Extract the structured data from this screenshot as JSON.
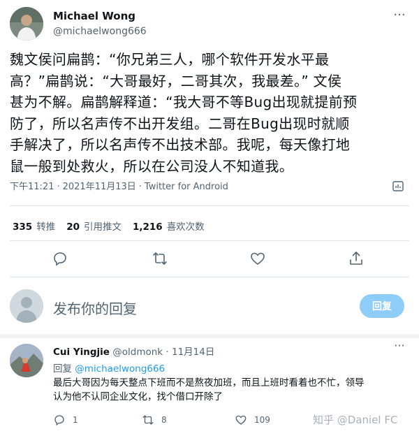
{
  "tweet": {
    "author_name": "Michael Wong",
    "author_handle": "@michaelwong666",
    "more_icon": "more-horizontal-icon",
    "text_lines": [
      "魏文侯问扁鹊：“你兄弟三人，哪个软件开发水平最",
      "高？”扁鹊说：“大哥最好，二哥其次，我最差。” 文侯",
      "甚为不解。扁鹊解释道：“我大哥不等Bug出现就提前预",
      "防了，所以名声传不出开发组。二哥在Bug出现时就顺",
      "手解决了，所以名声传不出技术部。我呢，每天像打地",
      "鼠一般到处救火，所以在公司没人不知道我。"
    ],
    "time": "下午11:21",
    "date": "2021年11月13日",
    "separator": "·",
    "client": "Twitter for Android",
    "analytics_icon": "analytics-icon"
  },
  "stats": {
    "retweets_count": "335",
    "retweets_label": "转推",
    "quotes_count": "20",
    "quotes_label": "引用推文",
    "likes_count": "1,216",
    "likes_label": "喜欢次数"
  },
  "actions": [
    "reply-icon",
    "retweet-icon",
    "like-icon",
    "share-icon"
  ],
  "composer": {
    "placeholder": "发布你的回复",
    "button_label": "回复",
    "button_color": "#8ecdf7"
  },
  "comment": {
    "name": "Cui Yingjie",
    "handle": "@oldmonk",
    "separator": "·",
    "date": "11月14日",
    "replying_label": "回复",
    "replying_to": "@michaelwong666",
    "text_lines": [
      "最后大哥因为每天整点下班而不是熬夜加班，而且上班时看着也不忙，领导",
      "认为他不认同企业文化，找个借口开除了"
    ],
    "reply_count": "1",
    "retweet_count": "8",
    "like_count": "109"
  },
  "watermark": "知乎 @Daniel FC",
  "colors": {
    "text_primary": "#0f1419",
    "text_secondary": "#536471",
    "link": "#1d9bf0",
    "divider": "#dfe4e8"
  }
}
